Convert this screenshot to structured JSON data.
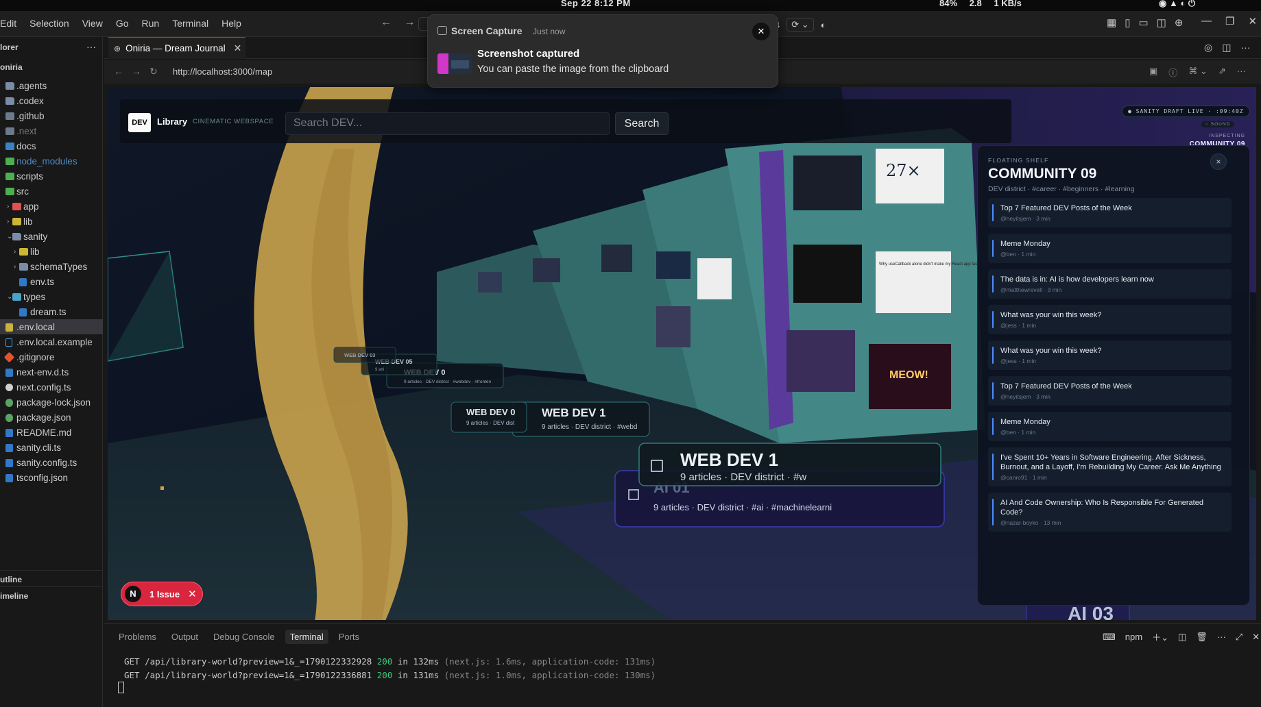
{
  "os_bar": {
    "datetime": "Sep 22   8:12 PM",
    "stats": [
      "84%",
      "2.8",
      "1 KB/s"
    ]
  },
  "menubar": {
    "items": [
      "Edit",
      "Selection",
      "View",
      "Go",
      "Run",
      "Terminal",
      "Help"
    ],
    "count_badge": "4"
  },
  "sidebar": {
    "title": "lorer",
    "root": "oniria",
    "tree": [
      {
        "label": ".agents",
        "depth": 0,
        "icon": "folder",
        "chevron": ""
      },
      {
        "label": ".codex",
        "depth": 0,
        "icon": "folder",
        "chevron": ""
      },
      {
        "label": ".github",
        "depth": 0,
        "icon": "folder-gray",
        "chevron": ""
      },
      {
        "label": ".next",
        "depth": 0,
        "icon": "folder-gray",
        "chevron": "",
        "style": "dim"
      },
      {
        "label": "docs",
        "depth": 0,
        "icon": "folder-blue",
        "chevron": ""
      },
      {
        "label": "node_modules",
        "depth": 0,
        "icon": "folder-green",
        "chevron": "",
        "style": "gitdim"
      },
      {
        "label": "scripts",
        "depth": 0,
        "icon": "folder-green",
        "chevron": ""
      },
      {
        "label": "src",
        "depth": 0,
        "icon": "folder-green",
        "chevron": ""
      },
      {
        "label": "app",
        "depth": 1,
        "icon": "folder-red",
        "chevron": "›"
      },
      {
        "label": "lib",
        "depth": 1,
        "icon": "folder-yellow",
        "chevron": "›"
      },
      {
        "label": "sanity",
        "depth": 1,
        "icon": "folder",
        "chevron": "⌄"
      },
      {
        "label": "lib",
        "depth": 2,
        "icon": "folder-yellow",
        "chevron": "›"
      },
      {
        "label": "schemaTypes",
        "depth": 2,
        "icon": "folder",
        "chevron": "›"
      },
      {
        "label": "env.ts",
        "depth": 2,
        "icon": "file-blue",
        "chevron": ""
      },
      {
        "label": "types",
        "depth": 1,
        "icon": "folder-cyan",
        "chevron": "⌄"
      },
      {
        "label": "dream.ts",
        "depth": 2,
        "icon": "file-blue",
        "chevron": ""
      },
      {
        "label": ".env.local",
        "depth": 0,
        "icon": "file-yellow",
        "chevron": "",
        "style": "selected"
      },
      {
        "label": ".env.local.example",
        "depth": 0,
        "icon": "file-outline",
        "chevron": ""
      },
      {
        "label": ".gitignore",
        "depth": 0,
        "icon": "file-orange",
        "chevron": ""
      },
      {
        "label": "next-env.d.ts",
        "depth": 0,
        "icon": "file-blue",
        "chevron": ""
      },
      {
        "label": "next.config.ts",
        "depth": 0,
        "icon": "file-white",
        "chevron": ""
      },
      {
        "label": "package-lock.json",
        "depth": 0,
        "icon": "file-green",
        "chevron": ""
      },
      {
        "label": "package.json",
        "depth": 0,
        "icon": "file-green",
        "chevron": ""
      },
      {
        "label": "README.md",
        "depth": 0,
        "icon": "file-blue",
        "chevron": ""
      },
      {
        "label": "sanity.cli.ts",
        "depth": 0,
        "icon": "file-blue",
        "chevron": ""
      },
      {
        "label": "sanity.config.ts",
        "depth": 0,
        "icon": "file-blue",
        "chevron": ""
      },
      {
        "label": "tsconfig.json",
        "depth": 0,
        "icon": "file-blue",
        "chevron": ""
      }
    ],
    "outline_label": "utline",
    "timeline_label": "imeline"
  },
  "editor_tab": {
    "title": "Oniria — Dream Journal"
  },
  "browser": {
    "url": "http://localhost:3000/map"
  },
  "site": {
    "logo": "DEV",
    "brand": "Library",
    "tagline": "CINEMATIC WEBSPACE",
    "search_placeholder": "Search DEV...",
    "search_button": "Search",
    "draft_badge": "● SANITY DRAFT LIVE · :09:40Z",
    "sound_badge": "○ SOUND",
    "inspecting_label": "INSPECTING",
    "inspecting_value": "COMMUNITY 09",
    "scene_labels": [
      {
        "title": "WEB DEV 1",
        "meta": "9 articles · DEV district · #w"
      },
      {
        "title": "AI 01",
        "meta": "9 articles · DEV district · #ai · #machinelearni"
      },
      {
        "title": "WEB DEV 1",
        "meta": "9 articles · DEV district · #webd"
      },
      {
        "title": "WEB DEV 0",
        "meta": "9 articles · DEV dist"
      },
      {
        "title": "WEB DEV 0",
        "meta": "9 articles · DEV district · #webdev · #fronten"
      },
      {
        "title": "WEB DEV 05",
        "meta": "9 arti"
      },
      {
        "title": "WEB DEV 03",
        "meta": ""
      },
      {
        "title": "AI 03",
        "meta": ""
      }
    ],
    "screen_texts": [
      "27×",
      "Why useCallback alone didn't make my React app faster — and what it's actually for",
      "MEOW!"
    ]
  },
  "shelf": {
    "eyebrow": "FLOATING SHELF",
    "title": "COMMUNITY 09",
    "subtitle": "DEV district · #career · #beginners · #learning",
    "close": "×",
    "items": [
      {
        "title": "Top 7 Featured DEV Posts of the Week",
        "meta": "@heyitsjem · 3 min"
      },
      {
        "title": "Meme Monday",
        "meta": "@ben · 1 min"
      },
      {
        "title": "The data is in: AI is how developers learn now",
        "meta": "@matthewrevell · 3 min"
      },
      {
        "title": "What was your win this week?",
        "meta": "@jess · 1 min"
      },
      {
        "title": "What was your win this week?",
        "meta": "@jess · 1 min"
      },
      {
        "title": "Top 7 Featured DEV Posts of the Week",
        "meta": "@heyitsjem · 3 min"
      },
      {
        "title": "Meme Monday",
        "meta": "@ben · 1 min"
      },
      {
        "title": "I've Spent 10+ Years in Software Engineering. After Sickness, Burnout, and a Layoff, I'm Rebuilding My Career. Ask Me Anything",
        "meta": "@canro91 · 1 min"
      },
      {
        "title": "AI And Code Ownership: Who Is Responsible For Generated Code?",
        "meta": "@nazar-boyko · 13 min"
      }
    ]
  },
  "issue_pill": {
    "icon_letter": "N",
    "label": "1 Issue"
  },
  "notification": {
    "app": "Screen Capture",
    "time": "Just now",
    "title": "Screenshot captured",
    "body": "You can paste the image from the clipboard"
  },
  "panel": {
    "tabs": [
      "Problems",
      "Output",
      "Debug Console",
      "Terminal",
      "Ports"
    ],
    "active_tab": "Terminal",
    "shell_label": "npm",
    "lines": [
      {
        "method": "GET",
        "path": "/api/library-world?preview=1&_=1790122332928",
        "status": "200",
        "time": "in 132ms",
        "detail": "(next.js: 1.6ms, application-code: 131ms)"
      },
      {
        "method": "GET",
        "path": "/api/library-world?preview=1&_=1790122336881",
        "status": "200",
        "time": "in 131ms",
        "detail": "(next.js: 1.0ms, application-code: 130ms)"
      }
    ]
  }
}
